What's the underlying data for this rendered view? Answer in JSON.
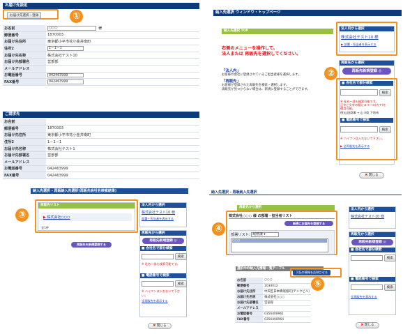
{
  "p1": {
    "header": "お届け先設定",
    "book_btn": "お届け先選択・登録",
    "badge": "①",
    "fields": [
      {
        "k": "お名前",
        "v": "○○○",
        "suffix": "様",
        "input": true
      },
      {
        "k": "郵便番号",
        "v": "1870003",
        "input": false
      },
      {
        "k": "お届け先住所",
        "v": "東京都小平市花小金井南町",
        "input": false
      },
      {
        "k": "住所2",
        "v": "1－1－1",
        "input": true
      },
      {
        "k": "お届け先名称",
        "v": "株式会社テスト10",
        "input": false
      },
      {
        "k": "お届け先部署名",
        "v": "営部部",
        "input": false
      },
      {
        "k": "メールアドレス",
        "v": "",
        "input": false
      },
      {
        "k": "お電話番号",
        "v": "042463999",
        "input": true
      },
      {
        "k": "FAX番号",
        "v": "042463999",
        "input": true
      }
    ],
    "header2": "ご請求先",
    "fields2": [
      {
        "k": "お名前",
        "v": ""
      },
      {
        "k": "郵便番号",
        "v": "1870003"
      },
      {
        "k": "お届け先住所",
        "v": "東京都小平市花小金井南町"
      },
      {
        "k": "住所2",
        "v": "1－1－1"
      },
      {
        "k": "お届け先名称",
        "v": "株式会社テスト1"
      },
      {
        "k": "お届け先部署名",
        "v": "営部部"
      },
      {
        "k": "メールアドレス",
        "v": ""
      },
      {
        "k": "お電話番号",
        "v": "042463999"
      },
      {
        "k": "FAX番号",
        "v": "042463999"
      }
    ]
  },
  "p2": {
    "window_title": "納入先選択 ウィンドウ・トップページ",
    "green_header": "納入先選択 TOP",
    "instruction1": "右側のメニューを操作して、",
    "instruction2": "法人または 再販先を選択してください。",
    "houjin_title": "「法人内」",
    "houjin_desc": "お客様の会社に登録されているご担当者様を選択します。",
    "saihan_title": "「再販先」",
    "saihan_desc1": "お客様が登録された再販先を検索・選択します。",
    "saihan_desc2": "再販先が見つからない場合は、新規に登録することができます。",
    "badge": "②",
    "side_houjin_head": "法人内から選択",
    "side_houjin_link": "株式会社テスト10 様",
    "side_houjin_more": "部署・担当者を表示する",
    "side_saihan_head": "再販先から選択",
    "new_btn": "再販先新規登録",
    "search_company_head": "会社名で部分検索",
    "search_btn": "検索",
    "note_company1": "※ 社名一部も検索可能です。",
    "note_company2": "正字と文字の間にスペース(カナ)を",
    "note_company3": "使用可能。",
    "example": "例)山田商事 → 山 A商 下地市",
    "search_phone_head": "電話番号で検索",
    "note_phone": "※ ハイフンは入れないで下さい。",
    "show_all": "全再販先を表示する",
    "close_btn": "閉じる"
  },
  "p3": {
    "window_title": "納入先選択 - 再販納入先選択(再販先会社名検索結果)",
    "badge": "③",
    "list_header": "再販先リスト",
    "list_item": "株式会社○○○",
    "list_footer": "全1件",
    "new_btn_small": "再販先を新規登録する",
    "side_houjin_head": "法人内から選択",
    "side_houjin_link": "株式会社テスト10 様",
    "side_houjin_more": "部署・担当者を表示する",
    "side_saihan_head": "再販先から選択",
    "new_btn": "再販先新規登録",
    "search_company_head": "会社名で部分検索",
    "search_btn": "検索",
    "note_company": "※ 社名一部も検索可能です。",
    "search_phone_head": "電話番号で検索",
    "note_phone": "※ ハイフンは入れないで下さい。",
    "show_all": "全再販先を表示する",
    "close_btn": "閉じる"
  },
  "p4": {
    "window_title": "納入先選択 - 再販納入先選択",
    "badge4": "④",
    "badge5": "⑤",
    "green_header": "再販先から選択",
    "company_title": "株式会社○○○ 様 の部署・担当者リスト",
    "add_btn": "新規にお届先を登録する",
    "dept_label": "部署リスト:",
    "dept_value": "総務課",
    "list_item": "○○○",
    "table_title": "選択中の納入先情報一覧テーブル",
    "reflect_btn": "下記の情報を反映させる",
    "rows": [
      {
        "k": "お名前",
        "v": "○○○"
      },
      {
        "k": "郵便番号",
        "v": "1030012"
      },
      {
        "k": "お届け先住所",
        "v": "中央区日本橋堀留町(テンクビル)"
      },
      {
        "k": "お届け先名称",
        "v": "株式会社○○○"
      },
      {
        "k": "お届け先部署名",
        "v": "営部部"
      },
      {
        "k": "メールアドレス",
        "v": ""
      },
      {
        "k": "お電話番号",
        "v": "0356408961"
      },
      {
        "k": "FAX番号",
        "v": "0356408964"
      }
    ],
    "side_houjin_head": "法人内から選択",
    "side_houjin_link": "株式会社テスト10 様",
    "side_saihan_head": "再販先から選択",
    "new_btn": "再販先新規登録",
    "search_company_head": "会社名で部分検索",
    "search_btn": "検索",
    "search_phone_head": "電話番号で検索",
    "show_all": "全再販先を表示する",
    "close_btn": "閉じる"
  },
  "colors": {
    "orange": "#f2911d",
    "navy": "#0d3a7a",
    "purple": "#6a55c2",
    "green": "#96c143",
    "red": "#d8141b"
  }
}
